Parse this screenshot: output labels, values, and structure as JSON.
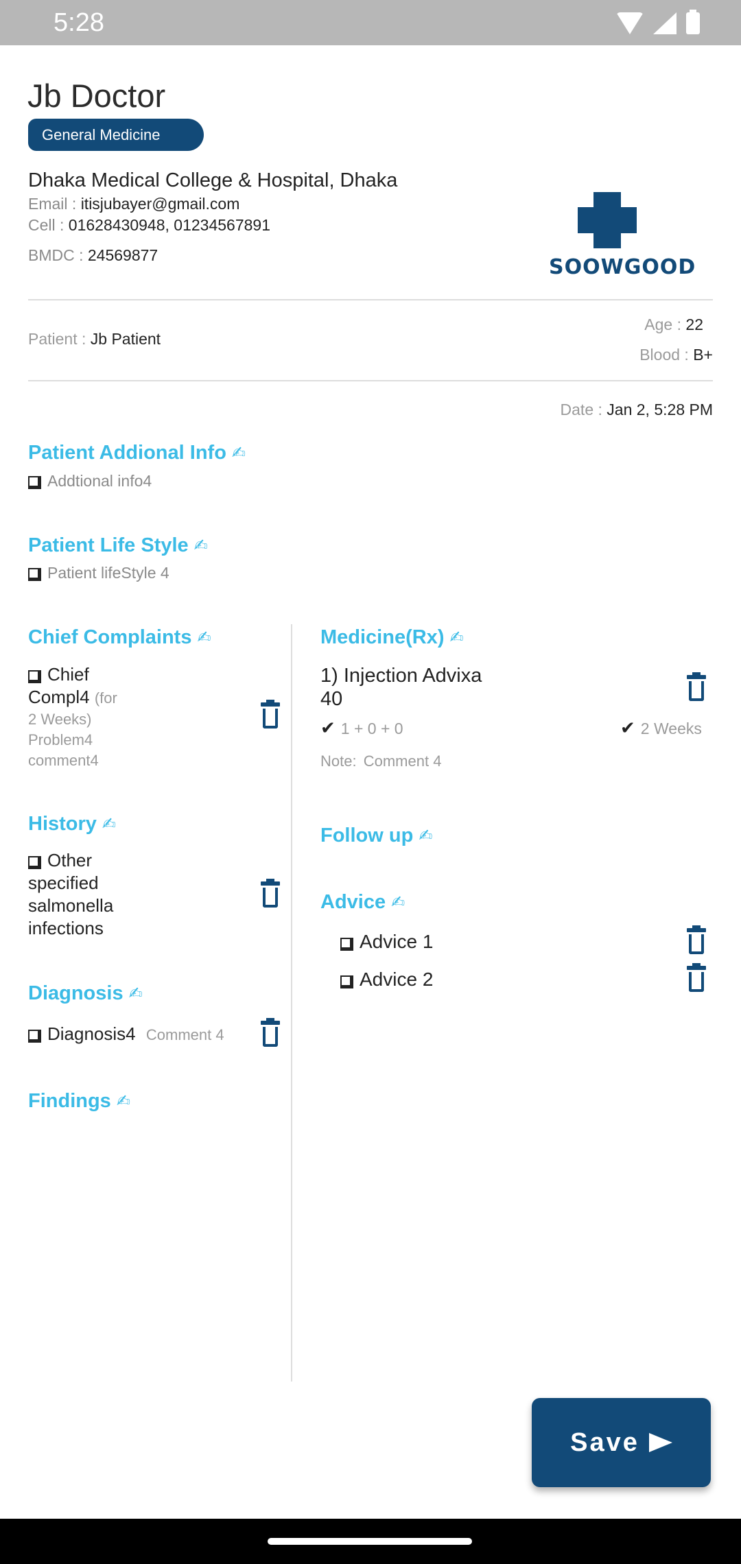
{
  "status_bar": {
    "time": "5:28"
  },
  "doctor": {
    "name": "Jb Doctor",
    "specialty": "General Medicine",
    "hospital": "Dhaka Medical College & Hospital, Dhaka",
    "email_label": "Email :",
    "email": "itisjubayer@gmail.com",
    "cell_label": "Cell :",
    "cell": "01628430948, 01234567891",
    "bmdc_label": "BMDC :",
    "bmdc": "24569877"
  },
  "logo": {
    "text": "SOOWGOOD",
    "color": "#124a78"
  },
  "patient": {
    "patient_label": "Patient :",
    "name": "Jb Patient",
    "age_label": "Age :",
    "age": "22",
    "blood_label": "Blood :",
    "blood": "B+"
  },
  "date": {
    "label": "Date :",
    "value": "Jan 2,  5:28 PM"
  },
  "sections": {
    "additional_info": {
      "title": "Patient Addional Info",
      "items": [
        "Addtional info4"
      ]
    },
    "lifestyle": {
      "title": "Patient Life Style",
      "items": [
        "Patient lifeStyle 4"
      ]
    },
    "chief_complaints": {
      "title": "Chief Complaints",
      "item_name_1": "Chief",
      "item_name_2": "Compl4",
      "item_duration_1": "(for",
      "item_duration_2": "2 Weeks)",
      "item_problem": "Problem4",
      "item_comment": "comment4"
    },
    "history": {
      "title": "History",
      "item_lines": [
        "Other",
        "specified",
        "salmonella",
        "infections"
      ]
    },
    "diagnosis": {
      "title": "Diagnosis",
      "item_name": "Diagnosis4",
      "item_comment": "Comment 4"
    },
    "findings": {
      "title": "Findings"
    },
    "medicine": {
      "title": "Medicine(Rx)",
      "item_name_1": "1) Injection Advixa",
      "item_name_2": "40",
      "dosage": "1 + 0 + 0",
      "duration": "2 Weeks",
      "note_label": "Note:",
      "note": "Comment 4"
    },
    "follow_up": {
      "title": "Follow up"
    },
    "advice": {
      "title": "Advice",
      "items": [
        "Advice 1",
        "Advice 2"
      ]
    }
  },
  "actions": {
    "save_label": "Save"
  },
  "colors": {
    "primary": "#124a78",
    "section_title": "#3bbbe6",
    "divider": "#dddddd"
  },
  "icons": {
    "edit": "writing-hand-icon",
    "delete": "trash-icon",
    "check": "check-icon",
    "save": "send-arrow-icon"
  }
}
